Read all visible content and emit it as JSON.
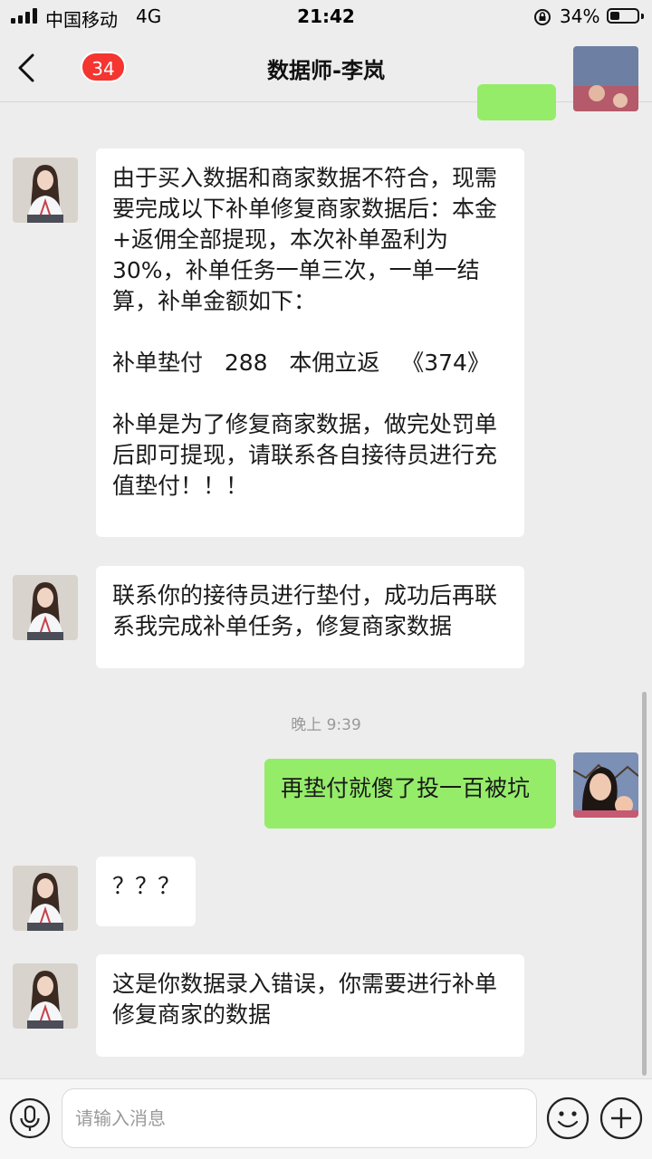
{
  "status_bar": {
    "carrier": "中国移动",
    "network": "4G",
    "time": "21:42",
    "battery": "34%",
    "battery_level": 0.34
  },
  "header": {
    "unread_count": "34",
    "title": "数据师-李岚"
  },
  "messages": [
    {
      "sender": "contact",
      "paragraphs": [
        "由于买入数据和商家数据不符合，现需要完成以下补单修复商家数据后：本金+返佣全部提现，本次补单盈利为30%，补单任务一单三次，一单一结算，补单金额如下：",
        "补单垫付   288   本佣立返   《374》",
        "补单是为了修复商家数据，做完处罚单后即可提现，请联系各自接待员进行充值垫付！！！"
      ]
    },
    {
      "sender": "contact",
      "paragraphs": [
        "联系你的接待员进行垫付，成功后再联系我完成补单任务，修复商家数据"
      ]
    },
    {
      "sender": "me",
      "paragraphs": [
        "再垫付就傻了投一百被坑"
      ]
    },
    {
      "sender": "contact",
      "paragraphs": [
        "？？？"
      ]
    },
    {
      "sender": "contact",
      "paragraphs": [
        "这是你数据录入错误，你需要进行补单修复商家的数据"
      ]
    }
  ],
  "timestamp": "晚上 9:39",
  "input": {
    "placeholder": "请输入消息"
  },
  "colors": {
    "background": "#ededed",
    "my_bubble": "#95ec69",
    "their_bubble": "#ffffff",
    "badge": "#f43530"
  },
  "icons": [
    "back-arrow-icon",
    "more-icon",
    "microphone-icon",
    "emoji-icon",
    "plus-icon"
  ]
}
